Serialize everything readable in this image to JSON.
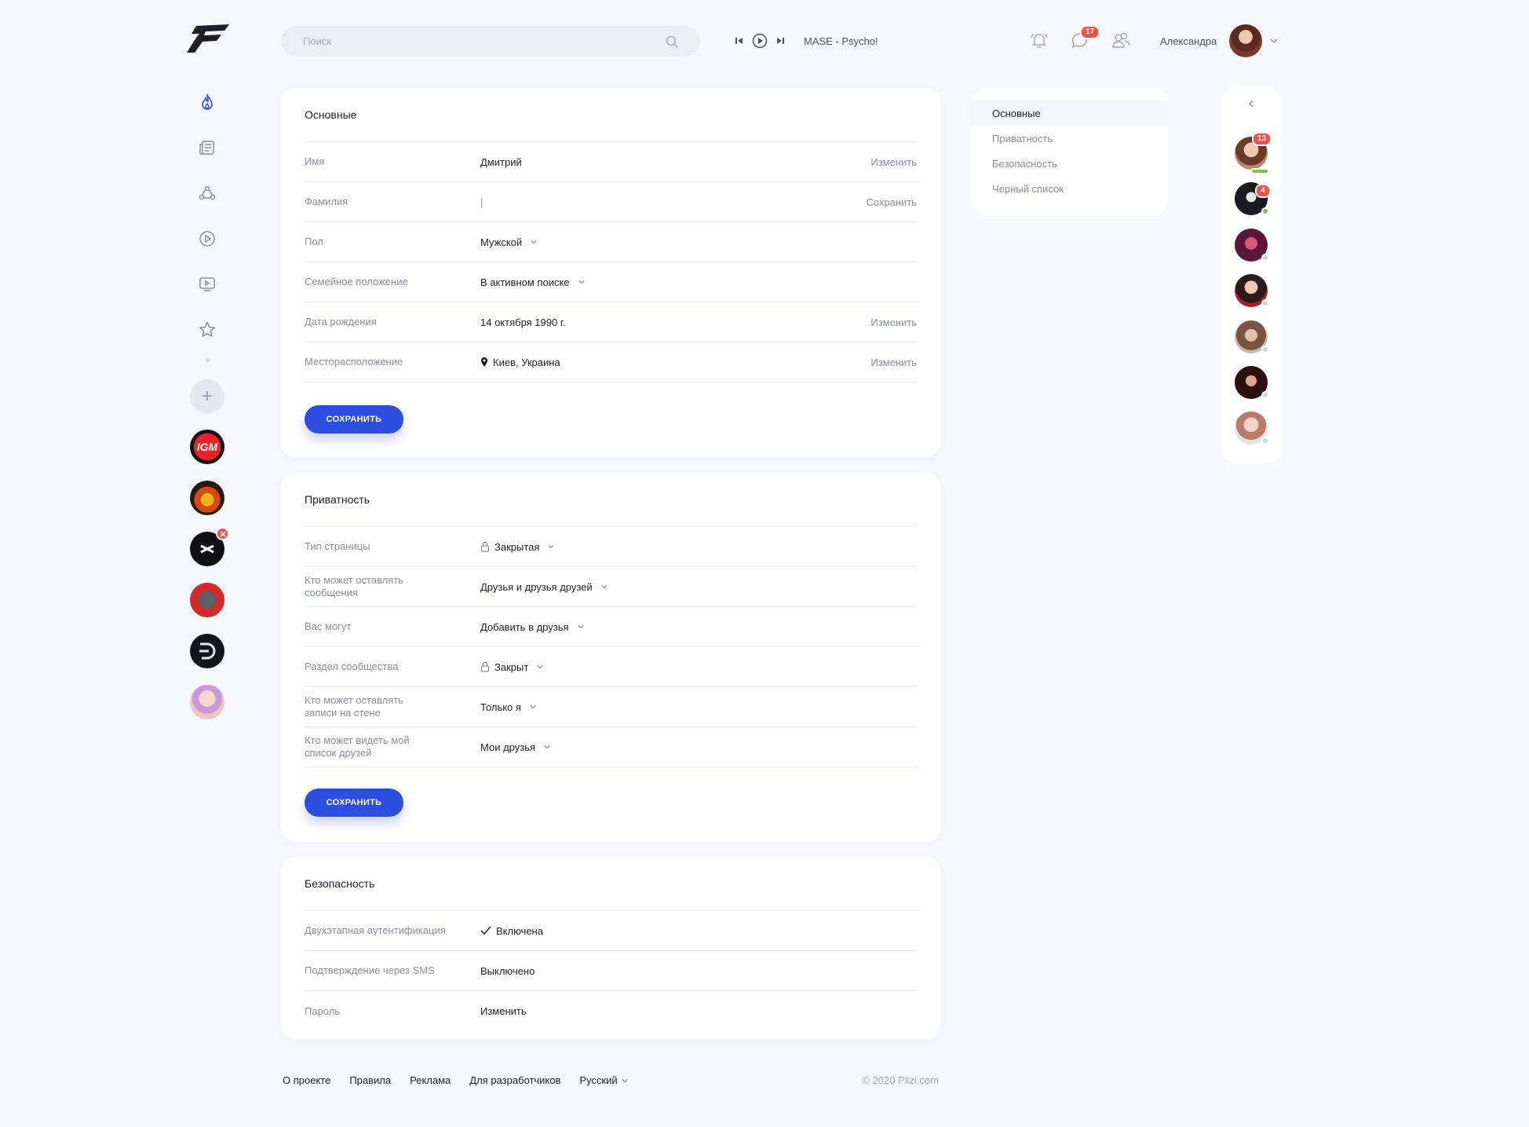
{
  "search": {
    "placeholder": "Поиск"
  },
  "player": {
    "track": "MASE - Psycho!"
  },
  "header": {
    "messages_badge": "17",
    "user_name": "Александра"
  },
  "groups": [
    {
      "name": "IGM"
    },
    {
      "name": "star"
    },
    {
      "name": "x"
    },
    {
      "name": "wolf"
    },
    {
      "name": "D"
    },
    {
      "name": "girl"
    }
  ],
  "friends_badges": {
    "first": "13",
    "second": "4"
  },
  "basic": {
    "title": "Основные",
    "rows": [
      {
        "label": "Имя",
        "value": "Дмитрий",
        "action": "Изменить"
      },
      {
        "label": "Фамилия",
        "value": "|",
        "action": "Сохранить"
      },
      {
        "label": "Пол",
        "value": "Мужской",
        "action": ""
      },
      {
        "label": "Семейное положение",
        "value": "В активном поиске",
        "action": ""
      },
      {
        "label": "Дата рождения",
        "value": "14 октября 1990 г.",
        "action": "Изменить"
      },
      {
        "label": "Месторасположение",
        "value": "Киев, Украина",
        "action": "Изменить"
      }
    ],
    "save": "СОХРАНИТЬ"
  },
  "privacy": {
    "title": "Приватность",
    "rows": [
      {
        "label": "Тип страницы",
        "value": "Закрытая"
      },
      {
        "label": "Кто может оставлять сообщения",
        "value": "Друзья и друзья друзей"
      },
      {
        "label": "Вас могут",
        "value": "Добавить в друзья"
      },
      {
        "label": "Раздел сообщества",
        "value": "Закрыт"
      },
      {
        "label": "Кто может оставлять записи на стене",
        "value": "Только я"
      },
      {
        "label": "Кто может видеть мой список друзей",
        "value": "Мои друзья"
      }
    ],
    "save": "СОХРАНИТЬ"
  },
  "security": {
    "title": "Безопасность",
    "rows": [
      {
        "label": "Двухэтапная аутентификация",
        "value": "Включена"
      },
      {
        "label": "Подтверждение через SMS",
        "value": "Выключено"
      },
      {
        "label": "Пароль",
        "value": "Изменить"
      }
    ]
  },
  "settings_menu": [
    "Основные",
    "Приватность",
    "Безопасность",
    "Черный список"
  ],
  "footer": {
    "links": [
      "О проекте",
      "Правила",
      "Реклама",
      "Для разработчиков",
      "Русский"
    ],
    "copyright": "© 2020 Plizi.com"
  },
  "colors": {
    "accent": "#2b4de0",
    "badge": "#f25148",
    "online": "#7ac943"
  }
}
